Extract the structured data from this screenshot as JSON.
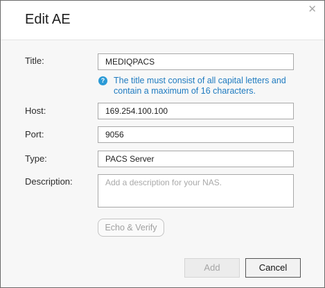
{
  "dialog": {
    "title": "Edit AE",
    "close_glyph": "✕"
  },
  "form": {
    "title_label": "Title:",
    "title_value": "MEDIQPACS",
    "title_hint": "The title must consist of all capital letters and contain a maximum of 16 characters.",
    "host_label": "Host:",
    "host_value": "169.254.100.100",
    "port_label": "Port:",
    "port_value": "9056",
    "type_label": "Type:",
    "type_value": "PACS Server",
    "description_label": "Description:",
    "description_placeholder": "Add a description for your NAS.",
    "echo_verify_label": "Echo & Verify"
  },
  "footer": {
    "add_label": "Add",
    "cancel_label": "Cancel"
  },
  "icons": {
    "hint_icon": "info-icon",
    "close_icon": "close-icon"
  },
  "colors": {
    "hint_text": "#1f7bc0",
    "hint_icon_bg": "#2b9ad6",
    "panel_bg": "#f7f7f7"
  }
}
